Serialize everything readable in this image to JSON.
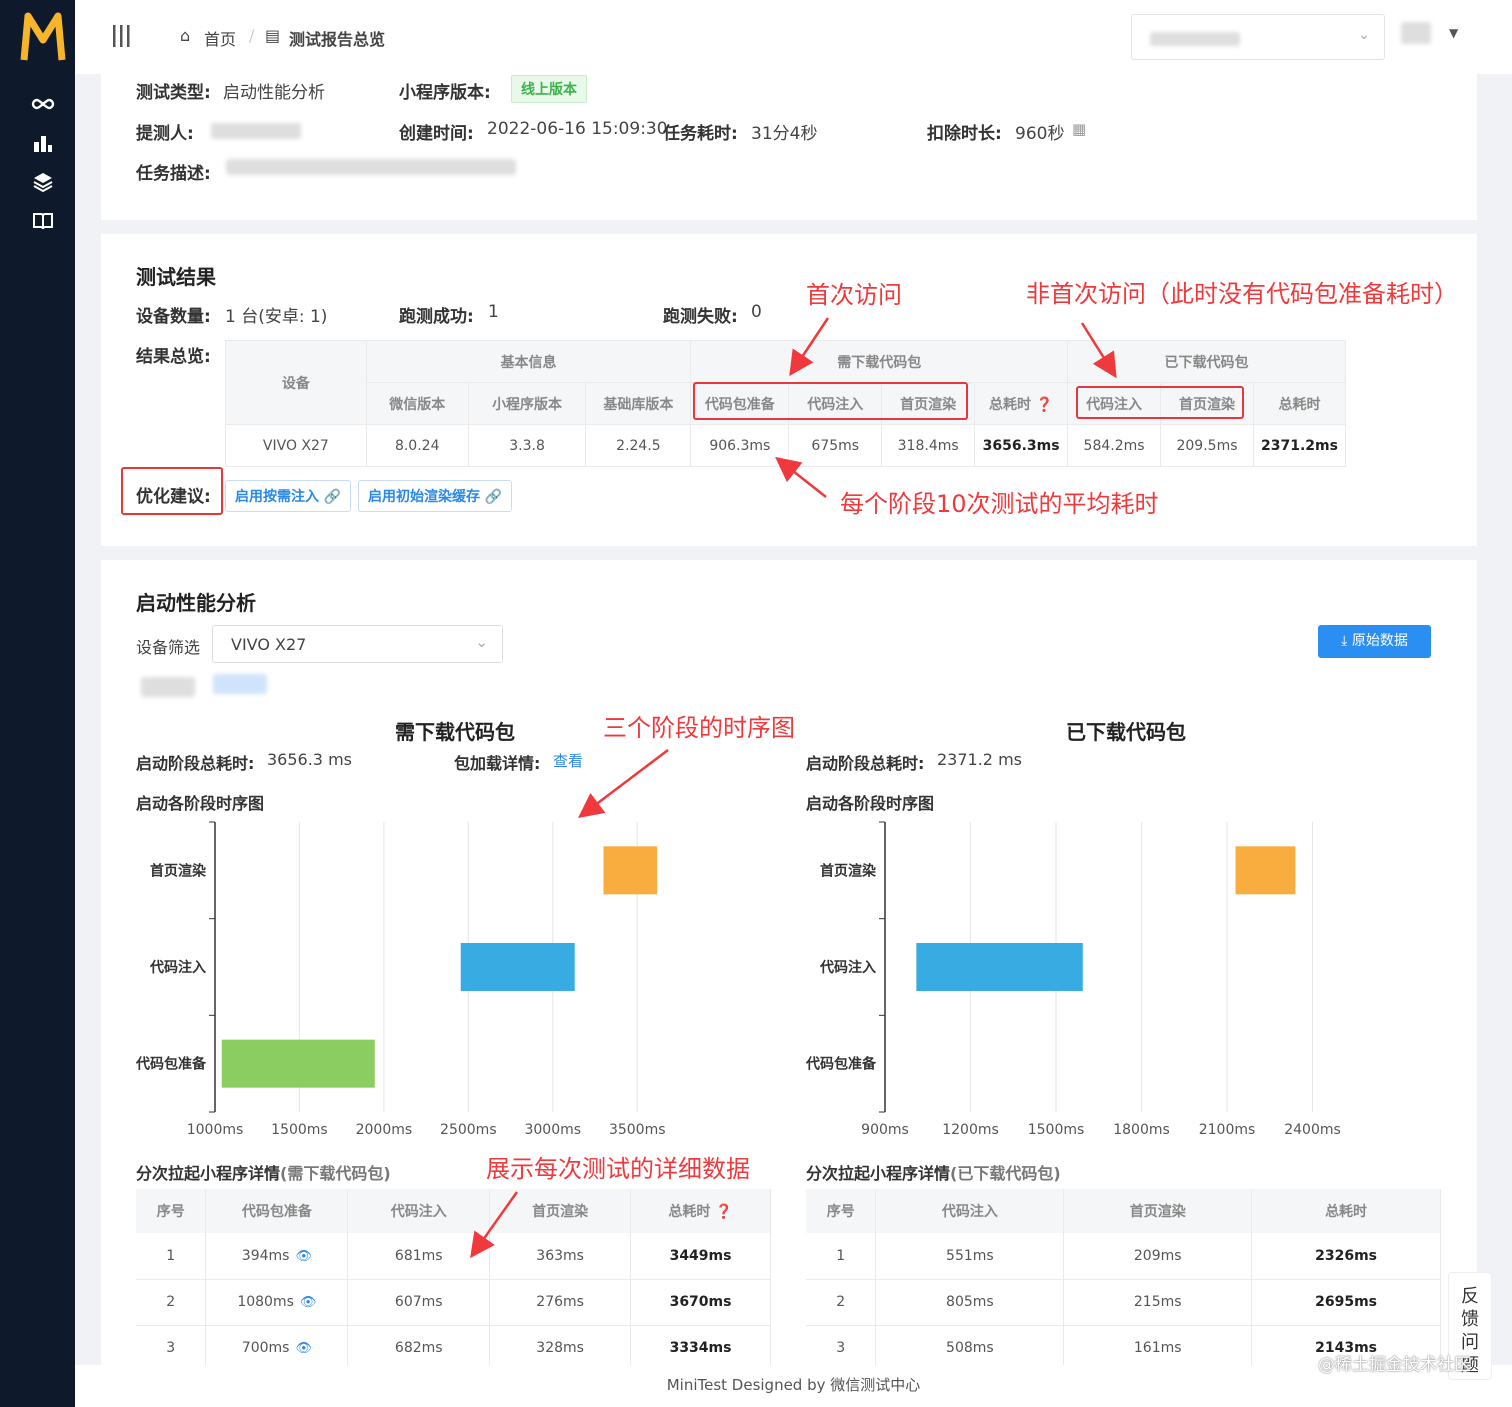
{
  "brand": {
    "logo_letter": "M",
    "accent": "#f7b52c",
    "sidebar_bg": "#0e1a2b",
    "primary": "#2a8ef2"
  },
  "sidebar": {
    "icons": [
      "infinity-icon",
      "bar-chart-icon",
      "layers-icon",
      "book-icon"
    ]
  },
  "breadcrumb": {
    "home": "首页",
    "separator": "/",
    "current": "测试报告总览"
  },
  "info": {
    "test_type_label": "测试类型:",
    "test_type": "启动性能分析",
    "version_label": "小程序版本:",
    "version_badge": "线上版本",
    "tester_label": "提测人:",
    "created_label": "创建时间:",
    "created": "2022-06-16 15:09:30",
    "duration_label": "任务耗时:",
    "duration": "31分4秒",
    "deduct_label": "扣除时长:",
    "deduct": "960秒",
    "desc_label": "任务描述:"
  },
  "results": {
    "title": "测试结果",
    "device_count_label": "设备数量:",
    "device_count": "1 台(安卓: 1)",
    "success_label": "跑测成功:",
    "success": "1",
    "fail_label": "跑测失败:",
    "fail": "0",
    "overview_label": "结果总览:",
    "groups": {
      "device": "设备",
      "basic": "基本信息",
      "need_dl": "需下载代码包",
      "downloaded": "已下载代码包"
    },
    "columns": {
      "wechat": "微信版本",
      "mp": "小程序版本",
      "lib": "基础库版本",
      "pkg": "代码包准备",
      "inject": "代码注入",
      "render": "首页渲染",
      "total": "总耗时",
      "inject2": "代码注入",
      "render2": "首页渲染",
      "total2": "总耗时"
    },
    "row": {
      "device": "VIVO X27",
      "wechat": "8.0.24",
      "mp": "3.3.8",
      "lib": "2.24.5",
      "pkg": "906.3ms",
      "inject": "675ms",
      "render": "318.4ms",
      "total": "3656.3ms",
      "inject2": "584.2ms",
      "render2": "209.5ms",
      "total2": "2371.2ms"
    },
    "optimize_label": "优化建议:",
    "tags": [
      "启用按需注入",
      "启用初始渲染缓存"
    ]
  },
  "annotations": {
    "first_visit": "首次访问",
    "non_first": "非首次访问（此时没有代码包准备耗时）",
    "avg": "每个阶段10次测试的平均耗时",
    "timing": "三个阶段的时序图",
    "detail": "展示每次测试的详细数据"
  },
  "analysis": {
    "title": "启动性能分析",
    "filter_label": "设备筛选",
    "filter_value": "VIVO X27",
    "raw_button": "原始数据",
    "left": {
      "heading": "需下载代码包",
      "total_label": "启动阶段总耗时:",
      "total": "3656.3 ms",
      "pkg_label": "包加载详情:",
      "pkg_link": "查看",
      "chart_title": "启动各阶段时序图"
    },
    "right": {
      "heading": "已下载代码包",
      "total_label": "启动阶段总耗时:",
      "total": "2371.2 ms",
      "chart_title": "启动各阶段时序图"
    }
  },
  "chart_data": [
    {
      "type": "bar",
      "orientation": "horizontal-range",
      "categories": [
        "首页渲染",
        "代码注入",
        "代码包准备"
      ],
      "ranges": [
        [
          3300,
          3618
        ],
        [
          2455,
          3130
        ],
        [
          1040,
          1946
        ]
      ],
      "colors": [
        "#f9ad3e",
        "#38ace2",
        "#8ccd62"
      ],
      "x_ticks": [
        1000,
        1500,
        2000,
        2500,
        3000,
        3500
      ],
      "x_tick_labels": [
        "1000ms",
        "1500ms",
        "2000ms",
        "2500ms",
        "3000ms",
        "3500ms"
      ],
      "xlim": [
        1000,
        3700
      ]
    },
    {
      "type": "bar",
      "orientation": "horizontal-range",
      "categories": [
        "首页渲染",
        "代码注入",
        "代码包准备"
      ],
      "ranges": [
        [
          2130,
          2340
        ],
        [
          1010,
          1594
        ],
        null
      ],
      "colors": [
        "#f9ad3e",
        "#38ace2",
        "#8ccd62"
      ],
      "x_ticks": [
        900,
        1200,
        1500,
        1800,
        2100,
        2400
      ],
      "x_tick_labels": [
        "900ms",
        "1200ms",
        "1500ms",
        "1800ms",
        "2100ms",
        "2400ms"
      ],
      "xlim": [
        900,
        2500
      ]
    }
  ],
  "detail_left": {
    "title": "分次拉起小程序详情",
    "subtitle": "(需下载代码包)",
    "headers": [
      "序号",
      "代码包准备",
      "代码注入",
      "首页渲染",
      "总耗时"
    ],
    "rows": [
      [
        "1",
        "394ms",
        "681ms",
        "363ms",
        "3449ms"
      ],
      [
        "2",
        "1080ms",
        "607ms",
        "276ms",
        "3670ms"
      ],
      [
        "3",
        "700ms",
        "682ms",
        "328ms",
        "3334ms"
      ]
    ]
  },
  "detail_right": {
    "title": "分次拉起小程序详情",
    "subtitle": "(已下载代码包)",
    "headers": [
      "序号",
      "代码注入",
      "首页渲染",
      "总耗时"
    ],
    "rows": [
      [
        "1",
        "551ms",
        "209ms",
        "2326ms"
      ],
      [
        "2",
        "805ms",
        "215ms",
        "2695ms"
      ],
      [
        "3",
        "508ms",
        "161ms",
        "2143ms"
      ]
    ]
  },
  "footer": "MiniTest Designed by 微信测试中心",
  "feedback": "反馈问题",
  "watermark": "@稀土掘金技术社区"
}
